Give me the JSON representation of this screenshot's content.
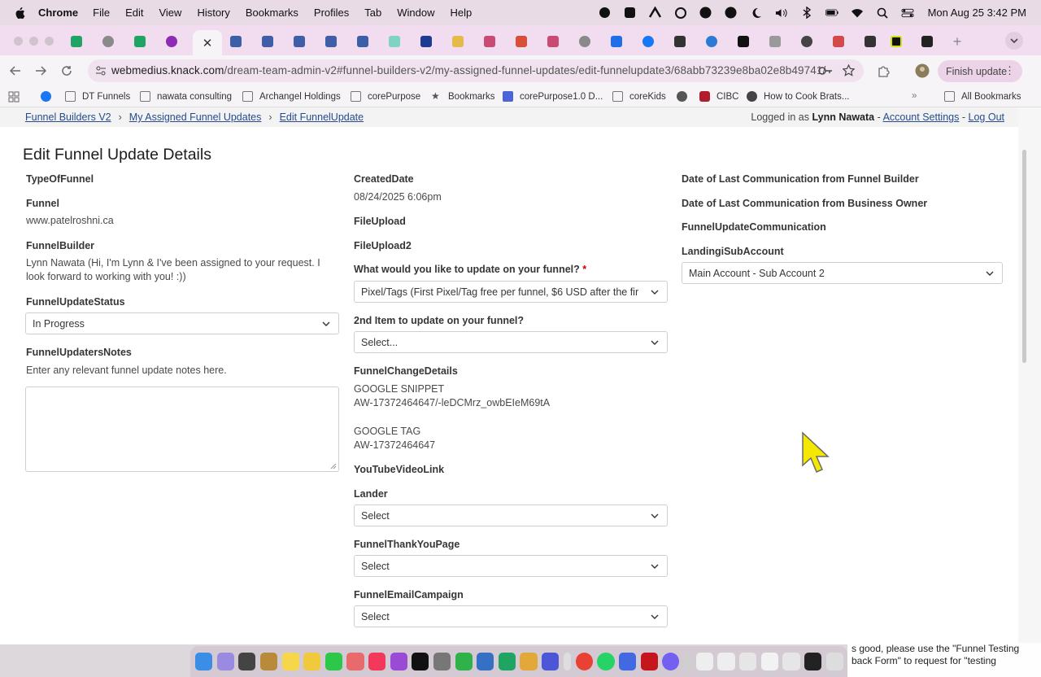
{
  "menubar": {
    "app_name": "Chrome",
    "items": [
      "File",
      "Edit",
      "View",
      "History",
      "Bookmarks",
      "Profiles",
      "Tab",
      "Window",
      "Help"
    ],
    "clock": "Mon Aug 25  3:42 PM"
  },
  "toolbar": {
    "url_host": "webmedius.knack.com",
    "url_path": "/dream-team-admin-v2#funnel-builders-v2/my-assigned-funnel-updates/edit-funnelupdate3/68abb73239e8ba02e8b49741/",
    "finish_update_label": "Finish update"
  },
  "bookmarks": {
    "items": [
      "DT Funnels",
      "nawata consulting",
      "Archangel Holdings",
      "corePurpose",
      "Bookmarks",
      "corePurpose1.0 D...",
      "coreKids",
      "CIBC",
      "How to Cook Brats..."
    ],
    "all_bookmarks": "All Bookmarks"
  },
  "page": {
    "breadcrumb": [
      "Funnel Builders V2",
      "My Assigned Funnel Updates",
      "Edit FunnelUpdate"
    ],
    "logged_in_prefix": "Logged in as",
    "user_name": "Lynn Nawata",
    "dash": "-",
    "account_settings": "Account Settings",
    "log_out": "Log Out",
    "title": "Edit Funnel Update Details"
  },
  "col1": {
    "type_of_funnel_label": "TypeOfFunnel",
    "funnel_label": "Funnel",
    "funnel_value": "www.patelroshni.ca",
    "builder_label": "FunnelBuilder",
    "builder_value": "Lynn Nawata (Hi, I'm Lynn & I've been assigned to your request. I look forward to working with you! :))",
    "status_label": "FunnelUpdateStatus",
    "status_value": "In Progress",
    "notes_label": "FunnelUpdatersNotes",
    "notes_hint": "Enter any relevant funnel update notes here."
  },
  "col2": {
    "created_label": "CreatedDate",
    "created_value": "08/24/2025 6:06pm",
    "file1_label": "FileUpload",
    "file2_label": "FileUpload2",
    "update_label": "What would you like to update on your funnel?",
    "required_mark": "*",
    "update_value": "Pixel/Tags (First Pixel/Tag free per funnel, $6 USD after the fir",
    "second_label": "2nd Item to update on your funnel?",
    "second_value": "Select...",
    "change_label": "FunnelChangeDetails",
    "change_lines": [
      "GOOGLE SNIPPET",
      "AW-17372464647/-leDCMrz_owbEIeM69tA",
      "GOOGLE TAG",
      "AW-17372464647"
    ],
    "youtube_label": "YouTubeVideoLink",
    "lander_label": "Lander",
    "lander_value": "Select",
    "thankyou_label": "FunnelThankYouPage",
    "thankyou_value": "Select",
    "email_label": "FunnelEmailCampaign",
    "email_value": "Select"
  },
  "col3": {
    "last_builder_label": "Date of Last Communication from Funnel Builder",
    "last_owner_label": "Date of Last Communication from Business Owner",
    "communication_label": "FunnelUpdateCommunication",
    "subaccount_label": "LandingiSubAccount",
    "subaccount_value": "Main Account - Sub Account 2"
  },
  "notification": {
    "line1": "s good, please use the \"Funnel Testing",
    "line2": "back Form\" to request for \"testing"
  },
  "colors": {
    "link": "#274b8e",
    "required": "#cc0000",
    "cursor": "#f5e800"
  }
}
